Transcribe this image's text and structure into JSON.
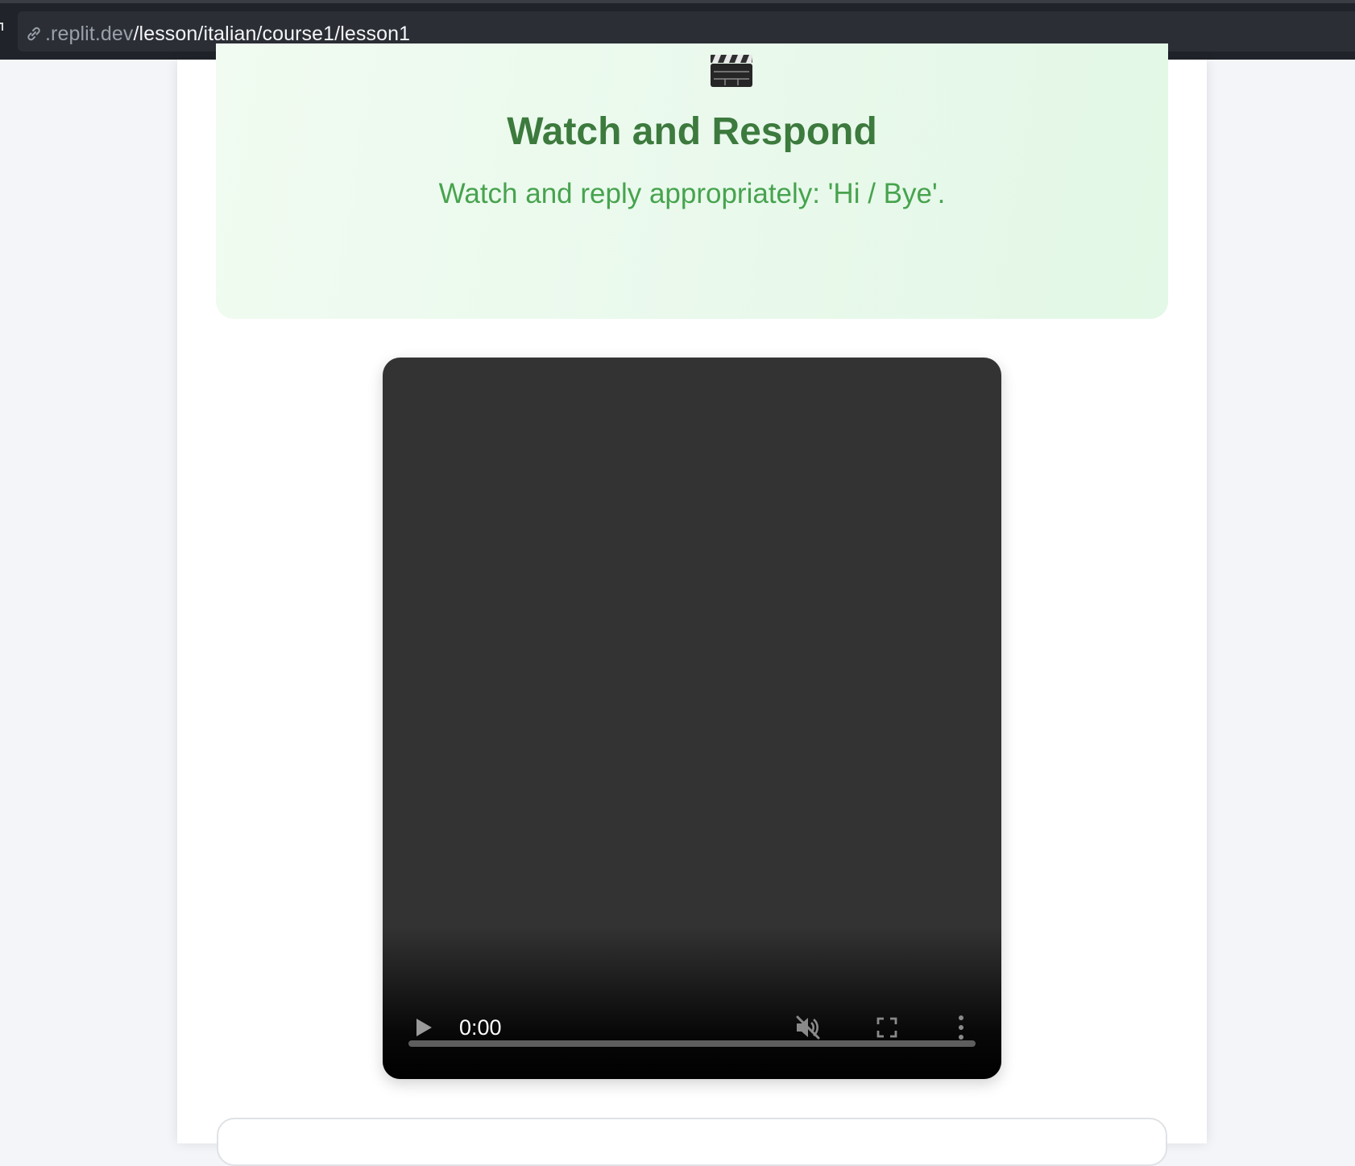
{
  "browser": {
    "url_host": ".replit.dev",
    "url_path": "/lesson/italian/course1/lesson1"
  },
  "lesson": {
    "icon": "clapper-board-icon",
    "title": "Watch and Respond",
    "instruction": "Watch and reply appropriately: 'Hi / Bye'."
  },
  "video": {
    "current_time": "0:00",
    "progress": 0,
    "muted": true,
    "controls": [
      "play-icon",
      "mute-icon",
      "fullscreen-icon",
      "more-options-icon"
    ]
  },
  "colors": {
    "title_green": "#3c7a3d",
    "subtitle_green": "#47a34e",
    "hero_bg": "#e9f9ec",
    "video_bg": "#333333"
  }
}
